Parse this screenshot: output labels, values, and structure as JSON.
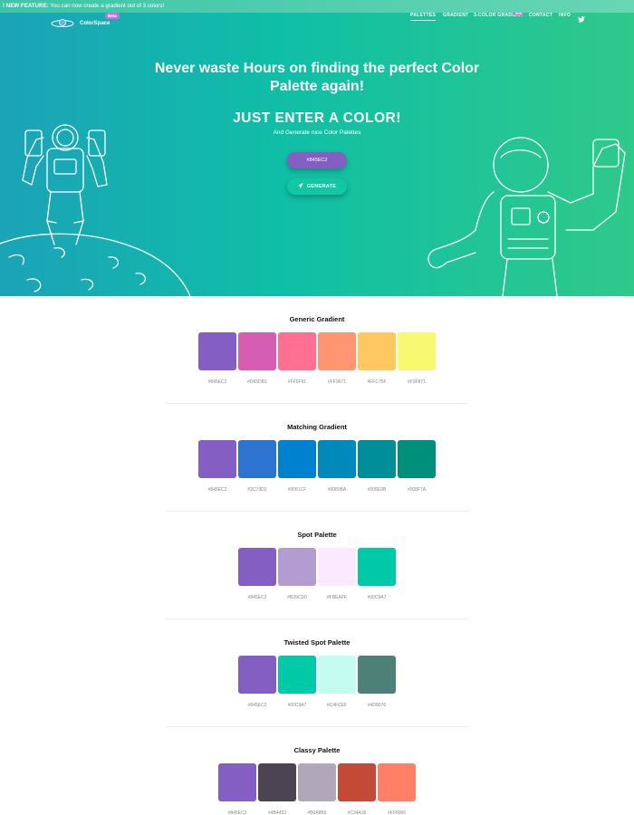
{
  "announcement": {
    "label": "! NEW FEATURE:",
    "text": "You can now create a gradient out of 3 colors!"
  },
  "header": {
    "logo_text": "ColorSpace",
    "beta_label": "Beta",
    "nav": [
      {
        "label": "PALETTES",
        "active": true
      },
      {
        "label": "GRADIENT",
        "active": false
      },
      {
        "label": "3-COLOR GRADIENT",
        "active": false
      },
      {
        "label": "CONTACT",
        "active": false
      },
      {
        "label": "INFO",
        "active": false
      }
    ],
    "new_label": "new",
    "twitter_icon": "twitter-icon"
  },
  "hero": {
    "title": "Never waste Hours on finding the perfect Color Palette again!",
    "subtitle": "JUST ENTER A COLOR!",
    "subtitle2": "And Generate nice Color Palettes",
    "input_value": "#845EC2",
    "generate_label": "GENERATE",
    "generate_icon": "paper-plane-icon"
  },
  "palettes": [
    {
      "title": "Generic Gradient",
      "colors": [
        {
          "hex": "#845EC2",
          "label": "#845EC2"
        },
        {
          "hex": "#D65DB1",
          "label": "#D65DB1"
        },
        {
          "hex": "#FF6F91",
          "label": "#FF6F91"
        },
        {
          "hex": "#FF9671",
          "label": "#FF9671"
        },
        {
          "hex": "#FFC75F",
          "label": "#FFC75F"
        },
        {
          "hex": "#F9F871",
          "label": "#F9F871"
        }
      ]
    },
    {
      "title": "Matching Gradient",
      "colors": [
        {
          "hex": "#845EC2",
          "label": "#845EC2"
        },
        {
          "hex": "#2C73D2",
          "label": "#2C73D2"
        },
        {
          "hex": "#0081CF",
          "label": "#0081CF"
        },
        {
          "hex": "#0089BA",
          "label": "#0089BA"
        },
        {
          "hex": "#008E9B",
          "label": "#008E9B"
        },
        {
          "hex": "#008F7A",
          "label": "#008F7A"
        }
      ]
    },
    {
      "title": "Spot Palette",
      "colors": [
        {
          "hex": "#845EC2",
          "label": "#845EC2"
        },
        {
          "hex": "#B39CD0",
          "label": "#B39CD0"
        },
        {
          "hex": "#FBEAFF",
          "label": "#FBEAFF"
        },
        {
          "hex": "#00C9A7",
          "label": "#00C9A7"
        }
      ]
    },
    {
      "title": "Twisted Spot Palette",
      "colors": [
        {
          "hex": "#845EC2",
          "label": "#845EC2"
        },
        {
          "hex": "#00C9A7",
          "label": "#00C9A7"
        },
        {
          "hex": "#C4FCEF",
          "label": "#C4FCEF"
        },
        {
          "hex": "#4D8076",
          "label": "#4D8076"
        }
      ]
    },
    {
      "title": "Classy Palette",
      "colors": [
        {
          "hex": "#845EC2",
          "label": "#845EC2"
        },
        {
          "hex": "#4B4453",
          "label": "#4B4453"
        },
        {
          "hex": "#B0A8B9",
          "label": "#B0A8B9"
        },
        {
          "hex": "#C34A36",
          "label": "#C34A36"
        },
        {
          "hex": "#FF8066",
          "label": "#FF8066"
        }
      ]
    }
  ]
}
